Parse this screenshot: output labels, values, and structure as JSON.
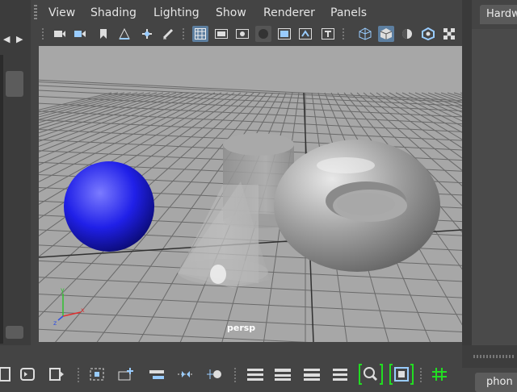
{
  "menubar": {
    "items": [
      "View",
      "Shading",
      "Lighting",
      "Show",
      "Renderer",
      "Panels"
    ]
  },
  "viewport": {
    "camera_label": "persp",
    "background_color": "#a7a7a7"
  },
  "right_panel": {
    "tab_label": "Hardw"
  },
  "bottom_right": {
    "tab_label": "phon"
  },
  "toolbar": {
    "icons": [
      "camera-icon",
      "camera-attributes-icon",
      "bookmark-icon",
      "image-plane-icon",
      "2d-pan-icon",
      "grease-pencil-icon",
      "grid-icon",
      "film-gate-icon",
      "resolution-gate-icon",
      "gate-mask-icon",
      "field-chart-icon",
      "safe-action-icon",
      "safe-title-icon",
      "wireframe-icon",
      "smooth-shade-icon",
      "use-default-material-icon",
      "xray-icon",
      "checkerboard-icon"
    ]
  },
  "bottom_toolbar": {
    "icons": [
      "layout-icon",
      "loop-icon",
      "export-icon",
      "frame-selection-icon",
      "add-node-icon",
      "remove-node-icon",
      "graph-icon",
      "connect-icon",
      "list-icon-1",
      "list-icon-2",
      "list-icon-3",
      "list-icon-4",
      "search-icon",
      "view-icon",
      "grid-snap-icon"
    ],
    "highlight_color": "#22dd22"
  },
  "axis_gizmo": {
    "x_color": "#e03030",
    "y_color": "#30c030",
    "z_color": "#3050e0"
  }
}
